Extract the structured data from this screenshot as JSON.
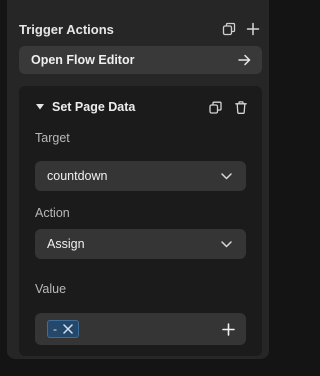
{
  "section": {
    "title": "Trigger Actions",
    "icons": [
      "copy-icon",
      "plus-icon"
    ]
  },
  "flow_editor": {
    "label": "Open Flow Editor",
    "icon": "arrow-right-icon"
  },
  "action_card": {
    "title": "Set Page Data",
    "icons": [
      "duplicate-icon",
      "trash-icon",
      "caret-down-icon"
    ],
    "target": {
      "label": "Target",
      "value": "countdown"
    },
    "action": {
      "label": "Action",
      "value": "Assign"
    },
    "value_field": {
      "label": "Value",
      "chip": "-"
    }
  },
  "colors": {
    "panel": "#262626",
    "card": "#1b1b1b",
    "input": "#353535",
    "chip_bg": "#24476a",
    "chip_border": "#3d6e99"
  }
}
